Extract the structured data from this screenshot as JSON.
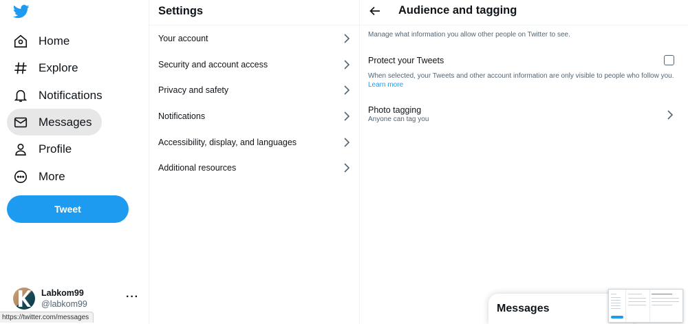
{
  "nav": {
    "items": [
      {
        "label": "Home",
        "icon": "home-icon"
      },
      {
        "label": "Explore",
        "icon": "hashtag-icon"
      },
      {
        "label": "Notifications",
        "icon": "bell-icon"
      },
      {
        "label": "Messages",
        "icon": "envelope-icon",
        "active": true
      },
      {
        "label": "Profile",
        "icon": "person-icon"
      },
      {
        "label": "More",
        "icon": "more-circle-icon"
      }
    ],
    "tweet_label": "Tweet",
    "account": {
      "name": "Labkom99",
      "handle": "@labkom99",
      "more": "···"
    }
  },
  "settings": {
    "title": "Settings",
    "items": [
      {
        "label": "Your account"
      },
      {
        "label": "Security and account access"
      },
      {
        "label": "Privacy and safety"
      },
      {
        "label": "Notifications"
      },
      {
        "label": "Accessibility, display, and languages"
      },
      {
        "label": "Additional resources"
      }
    ]
  },
  "detail": {
    "title": "Audience and tagging",
    "description": "Manage what information you allow other people on Twitter to see.",
    "protect": {
      "label": "Protect your Tweets",
      "checked": false,
      "help": "When selected, your Tweets and other account information are only visible to people who follow you.",
      "learn_more": "Learn more"
    },
    "photo_tagging": {
      "title": "Photo tagging",
      "subtitle": "Anyone can tag you"
    }
  },
  "messages_drawer": {
    "title": "Messages"
  },
  "status_url": "https://twitter.com/messages",
  "colors": {
    "accent": "#1d9bf0",
    "text": "#0f1419",
    "muted": "#536471",
    "active_bg": "#e7e7e8"
  }
}
